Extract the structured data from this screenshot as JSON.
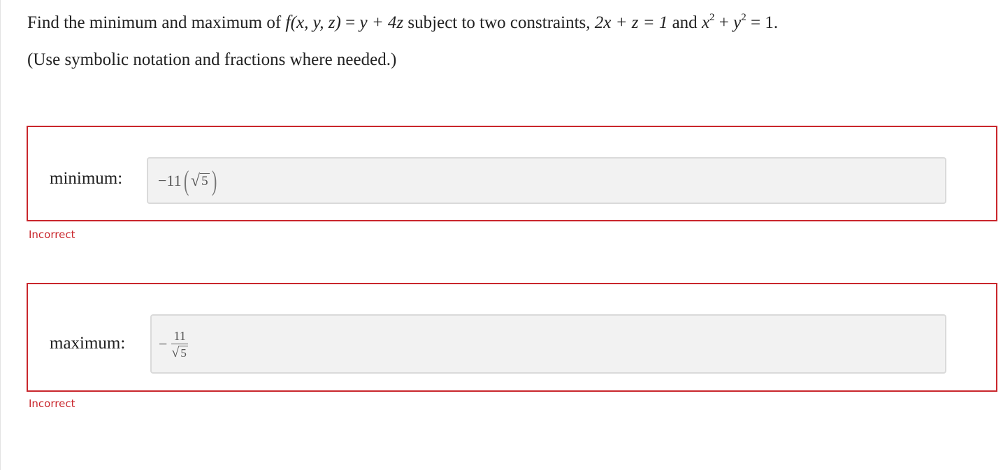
{
  "question": {
    "intro": "Find the minimum and maximum of ",
    "function_name": "f",
    "function_args": "(x, y, z)",
    "equals_1": " = ",
    "expression": "y + 4z",
    "middle_text": " subject to two constraints, ",
    "constraint_1": "2x + z = 1",
    "and_text": " and ",
    "constraint_2_x": "x",
    "constraint_2_exp": "2",
    "constraint_2_plus": " + ",
    "constraint_2_y": "y",
    "constraint_2_tail": " = 1."
  },
  "hint": "(Use symbolic notation and fractions where needed.)",
  "answers": {
    "minimum": {
      "label": "minimum:",
      "value_coeff": "−11",
      "value_radicand": "5",
      "feedback": "Incorrect"
    },
    "maximum": {
      "label": "maximum:",
      "value_sign": "−",
      "value_numerator": "11",
      "value_radicand": "5",
      "feedback": "Incorrect"
    }
  },
  "colors": {
    "error": "#c9262c",
    "field_bg": "#f2f2f2",
    "field_border": "#dadada"
  }
}
